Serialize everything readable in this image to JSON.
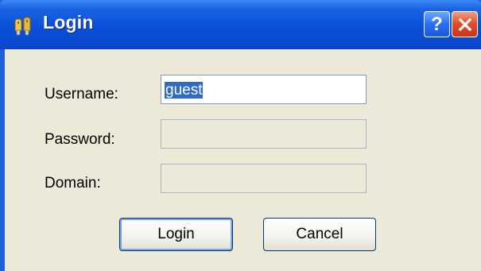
{
  "window": {
    "title": "Login",
    "help_label": "?",
    "close_label": "×"
  },
  "form": {
    "username_label": "Username:",
    "username_value": "guest",
    "password_label": "Password:",
    "password_value": "",
    "domain_label": "Domain:",
    "domain_value": ""
  },
  "buttons": {
    "login_label": "Login",
    "cancel_label": "Cancel"
  },
  "colors": {
    "titlebar": "#0a4fd6",
    "client_background": "#ece9d8",
    "selection": "#316ac5",
    "close_button": "#e0502a"
  },
  "icons": {
    "title_icon": "keys-icon",
    "help_icon": "question-icon",
    "close_icon": "close-icon"
  }
}
